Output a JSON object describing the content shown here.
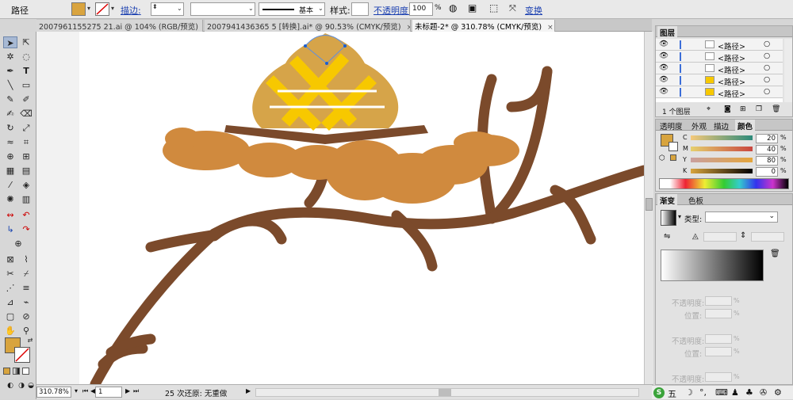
{
  "control_bar": {
    "object_type": "路径",
    "fill_color": "#d8a43e",
    "stroke_label": "描边:",
    "stroke_profile": "基本",
    "style_label": "样式:",
    "opacity_label": "不透明度:",
    "opacity_value": "100",
    "opacity_unit": "%",
    "transform_label": "变换"
  },
  "doc_tabs": [
    {
      "label": "2007961155275 21.ai @ 104% (RGB/预览)",
      "active": false
    },
    {
      "label": "2007941436365 5 [转换].ai* @ 90.53% (CMYK/预览)",
      "active": false
    },
    {
      "label": "未标题-2* @ 310.78% (CMYK/预览)",
      "active": true
    }
  ],
  "status_bar": {
    "zoom": "310.78%",
    "page": "1",
    "undo_status": "25 次还原: 无重做"
  },
  "layers_panel": {
    "title": "图层",
    "rows": [
      "<路径>",
      "<路径>",
      "<路径>",
      "<路径>",
      "<路径>"
    ],
    "footer_count": "1 个图层"
  },
  "color_panel": {
    "tabs": [
      "透明度",
      "外观",
      "描边",
      "颜色"
    ],
    "active_tab": "颜色",
    "channels": [
      {
        "name": "C",
        "value": "20"
      },
      {
        "name": "M",
        "value": "40"
      },
      {
        "name": "Y",
        "value": "80"
      },
      {
        "name": "K",
        "value": "0"
      }
    ],
    "percent": "%"
  },
  "gradient_panel": {
    "tabs": [
      "渐变",
      "色板"
    ],
    "type_label": "类型:",
    "opacity_label": "不透明度:",
    "location_label": "位置:",
    "percent": "%"
  },
  "ime_bar": {
    "mode": "五"
  },
  "artwork_colors": {
    "branch": "#7b4a2b",
    "cushion": "#d08a3e",
    "bun": "#d6a449",
    "bun_yellow": "#f7c800"
  }
}
